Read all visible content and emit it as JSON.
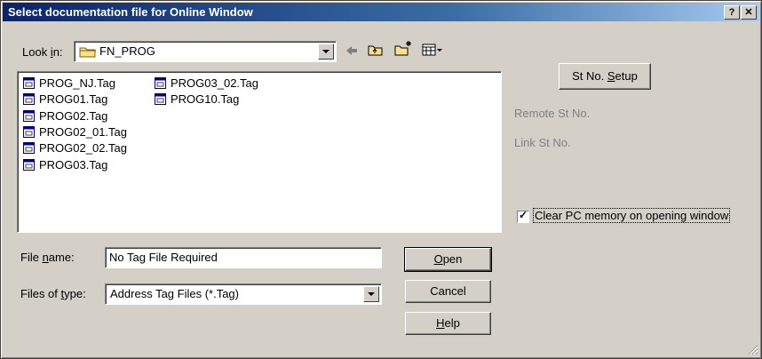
{
  "window": {
    "title": "Select documentation file for Online Window",
    "help_btn": "?",
    "close_btn": "✕"
  },
  "look_in": {
    "label_pre": "Look ",
    "label_ul": "i",
    "label_post": "n:",
    "value": "FN_PROG"
  },
  "toolbar": {
    "back": "back-arrow-icon",
    "up": "up-folder-icon",
    "new_folder": "new-folder-icon",
    "view": "view-menu-icon"
  },
  "files": [
    "PROG_NJ.Tag",
    "PROG01.Tag",
    "PROG02.Tag",
    "PROG02_01.Tag",
    "PROG02_02.Tag",
    "PROG03.Tag",
    "PROG03_02.Tag",
    "PROG10.Tag"
  ],
  "file_name": {
    "label_pre": "File ",
    "label_ul": "n",
    "label_post": "ame:",
    "value": "No Tag File Required"
  },
  "file_type": {
    "label_pre": "Files of ",
    "label_ul": "t",
    "label_post": "ype:",
    "value": "Address Tag Files (*.Tag)"
  },
  "buttons": {
    "open_ul": "O",
    "open_rest": "pen",
    "cancel": "Cancel",
    "help_ul": "H",
    "help_rest": "elp"
  },
  "station": {
    "setup_pre": "St No. ",
    "setup_ul": "S",
    "setup_post": "etup",
    "remote": "Remote St No.",
    "link": "Link St No."
  },
  "clear_pc": {
    "checked": true,
    "label": "Clear PC memory on opening window"
  },
  "colors": {
    "face": "#d4d0c8",
    "title_start": "#0a246a",
    "title_end": "#a6caf0",
    "disabled_text": "#808080"
  }
}
